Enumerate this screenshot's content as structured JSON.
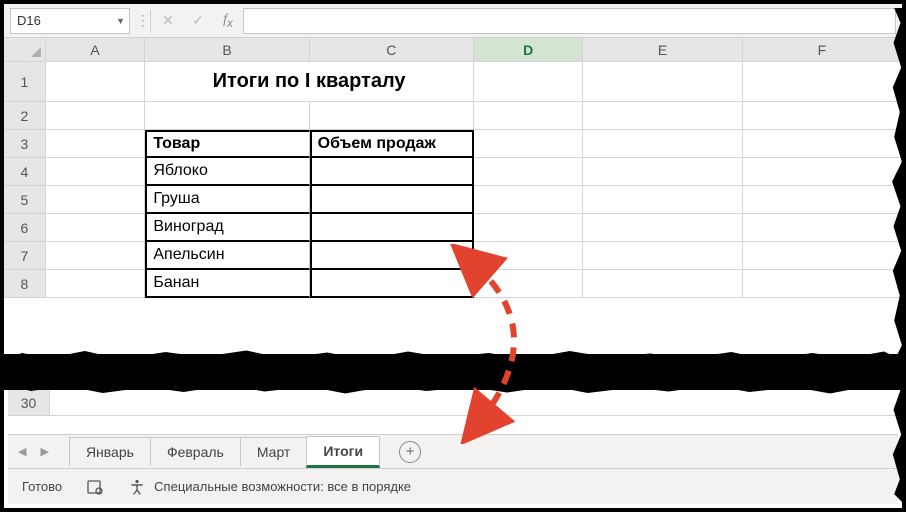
{
  "namebox": {
    "value": "D16"
  },
  "formula": {
    "value": ""
  },
  "columns": [
    "A",
    "B",
    "C",
    "D",
    "E",
    "F"
  ],
  "active_col": "D",
  "rows_top": [
    "1",
    "2",
    "3",
    "4",
    "5",
    "6",
    "7",
    "8"
  ],
  "row_bottom": "30",
  "title": "Итоги по I кварталу",
  "table": {
    "header": {
      "col1": "Товар",
      "col2": "Объем продаж"
    },
    "rows": [
      {
        "name": "Яблоко"
      },
      {
        "name": "Груша"
      },
      {
        "name": "Виноград"
      },
      {
        "name": "Апельсин"
      },
      {
        "name": "Банан"
      }
    ]
  },
  "sheet_tabs": [
    {
      "label": "Январь",
      "active": false
    },
    {
      "label": "Февраль",
      "active": false
    },
    {
      "label": "Март",
      "active": false
    },
    {
      "label": "Итоги",
      "active": true
    }
  ],
  "status": {
    "ready": "Готово",
    "accessibility": "Специальные возможности: все в порядке"
  }
}
